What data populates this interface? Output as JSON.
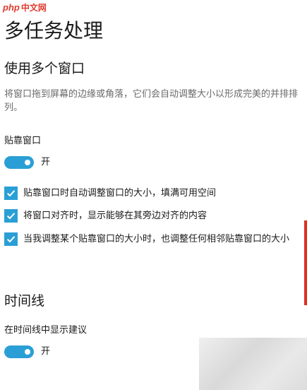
{
  "watermark": {
    "logo": "php",
    "text": "中文网"
  },
  "page_title": "多任务处理",
  "windows_section": {
    "heading": "使用多个窗口",
    "description": "将窗口拖到屏幕的边缘或角落，它们会自动调整大小以形成完美的并排排列。",
    "snap_label": "贴靠窗口",
    "snap_toggle": {
      "state": "开",
      "on": true
    },
    "options": [
      {
        "label": "贴靠窗口时自动调整窗口的大小，填满可用空间",
        "checked": true
      },
      {
        "label": "将窗口对齐时，显示能够在其旁边对齐的内容",
        "checked": true
      },
      {
        "label": "当我调整某个贴靠窗口的大小时，也调整任何相邻贴靠窗口的大小",
        "checked": true
      }
    ]
  },
  "timeline_section": {
    "heading": "时间线",
    "suggestions_label": "在时间线中显示建议",
    "suggestions_toggle": {
      "state": "开",
      "on": true
    }
  },
  "colors": {
    "accent": "#2a9fd6",
    "scroll_indicator": "#e0301e",
    "description_text": "#6a6a6a"
  }
}
